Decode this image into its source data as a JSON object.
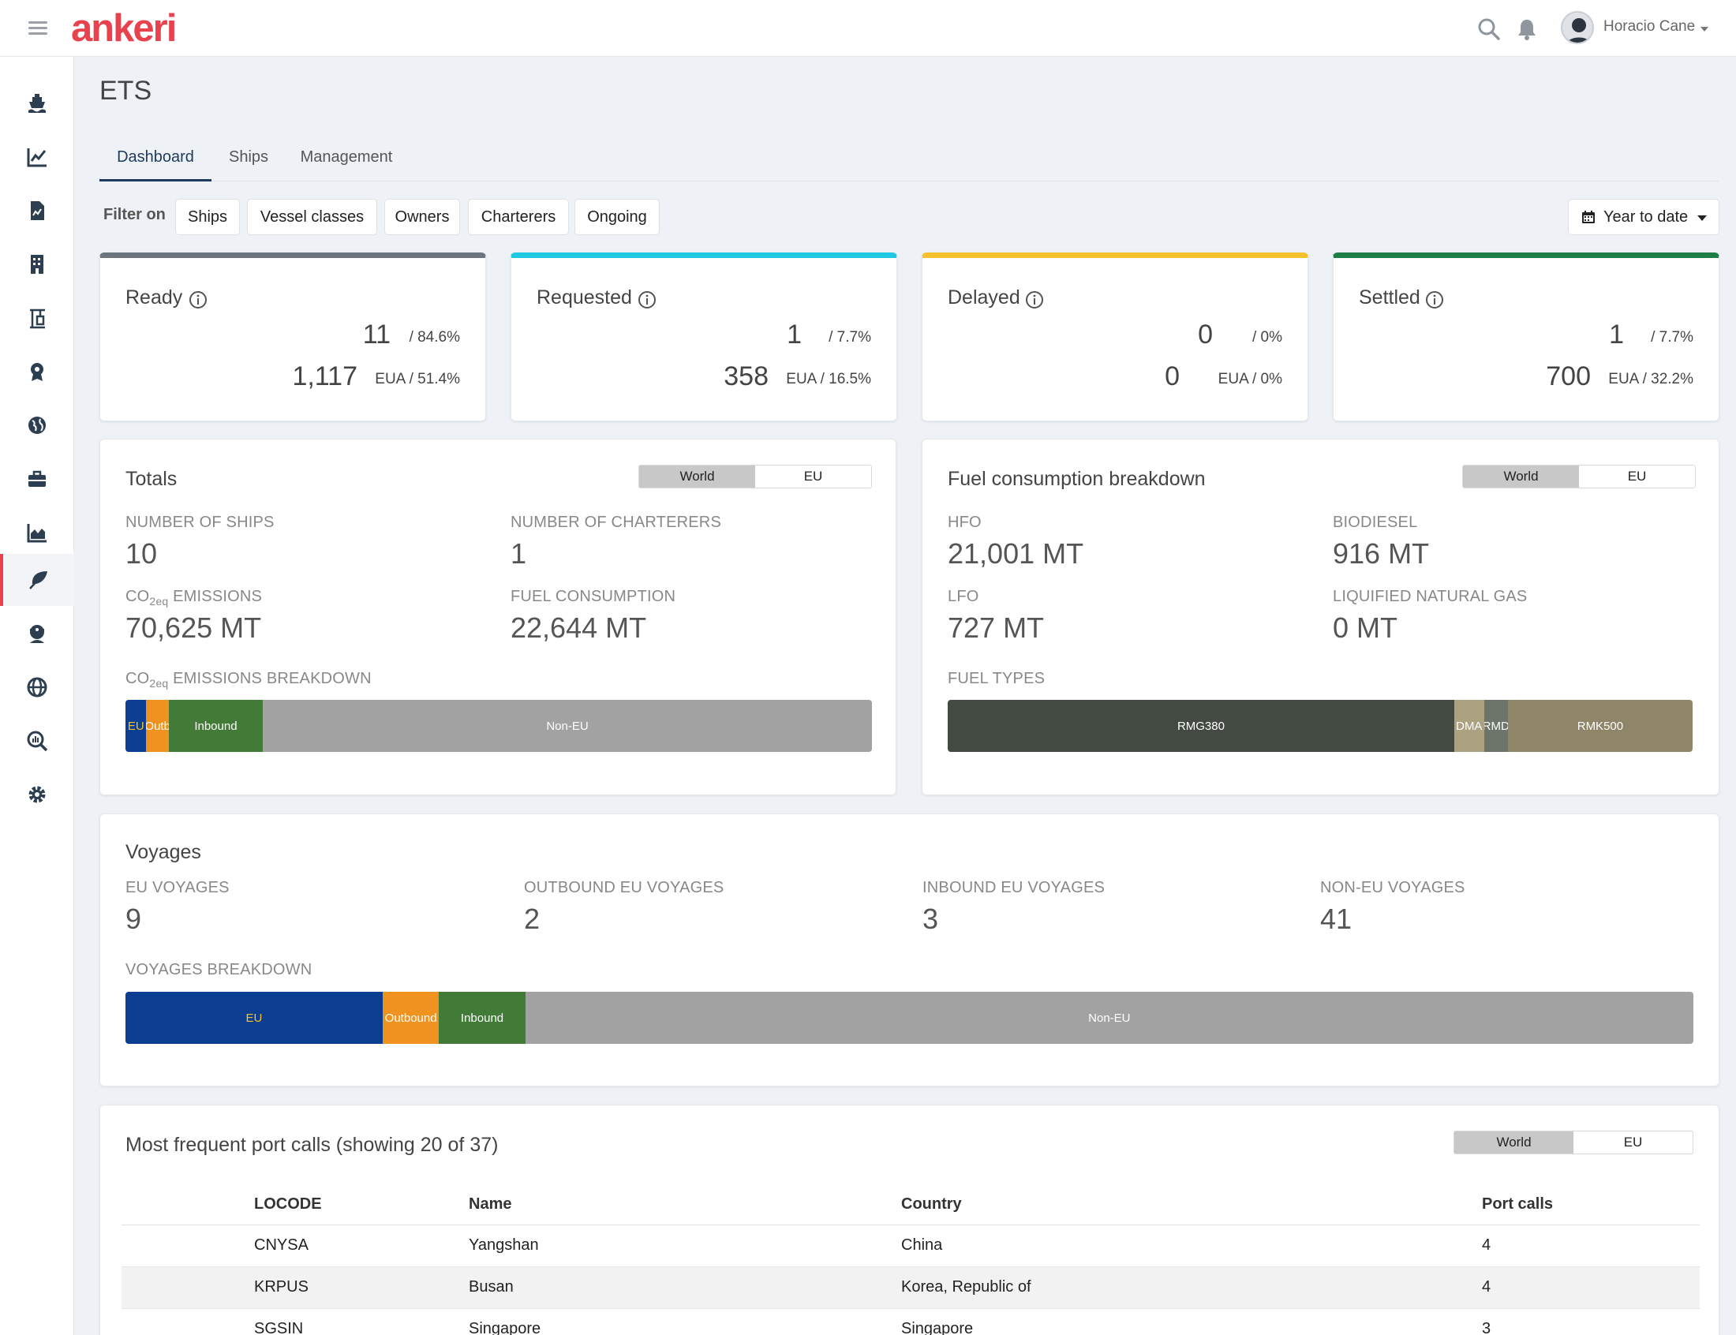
{
  "app": {
    "logo_text": "ankeri",
    "brand_color": "#e8424e",
    "user_name": "Horacio Cane"
  },
  "page_title": "ETS",
  "tabs": [
    {
      "label": "Dashboard",
      "active": true
    },
    {
      "label": "Ships",
      "active": false
    },
    {
      "label": "Management",
      "active": false
    }
  ],
  "filter": {
    "label": "Filter on",
    "chips": [
      "Ships",
      "Vessel classes",
      "Owners",
      "Charterers",
      "Ongoing"
    ],
    "date_range": "Year to date"
  },
  "status_cards": [
    {
      "title": "Ready",
      "count": "11",
      "count_pct": "/ 84.6%",
      "eua": "1,117",
      "eua_pct": "EUA / 51.4%",
      "color": "#6c757d"
    },
    {
      "title": "Requested",
      "count": "1",
      "count_pct": "/ 7.7%",
      "eua": "358",
      "eua_pct": "EUA / 16.5%",
      "color": "#1fc8e3"
    },
    {
      "title": "Delayed",
      "count": "0",
      "count_pct": "/ 0%",
      "eua": "0",
      "eua_pct": "EUA / 0%",
      "color": "#f5c12e"
    },
    {
      "title": "Settled",
      "count": "1",
      "count_pct": "/ 7.7%",
      "eua": "700",
      "eua_pct": "EUA / 32.2%",
      "color": "#1e7e45"
    }
  ],
  "totals": {
    "title": "Totals",
    "toggle": [
      "World",
      "EU"
    ],
    "toggle_selected": "World",
    "ships_label": "NUMBER OF SHIPS",
    "ships_value": "10",
    "charterers_label": "NUMBER OF CHARTERERS",
    "charterers_value": "1",
    "co2_label_pre": "CO",
    "co2_label_sub": "2eq",
    "co2_label_post": " EMISSIONS",
    "co2_value": "70,625 MT",
    "fuel_label": "FUEL CONSUMPTION",
    "fuel_value": "22,644 MT",
    "breakdown_label_post": " EMISSIONS BREAKDOWN",
    "breakdown": [
      {
        "label": "EU",
        "share": 2.8,
        "color": "#0b3d91",
        "text_color": "#f5c12e"
      },
      {
        "label": "Outb",
        "share": 3.0,
        "color": "#f0921f",
        "text_color": "#ffffff"
      },
      {
        "label": "Inbound",
        "share": 12.6,
        "color": "#417b37",
        "text_color": "#ffffff"
      },
      {
        "label": "Non-EU",
        "share": 81.6,
        "color": "#a2a2a2",
        "text_color": "#ffffff"
      }
    ]
  },
  "fuel": {
    "title": "Fuel consumption breakdown",
    "toggle": [
      "World",
      "EU"
    ],
    "toggle_selected": "World",
    "hfo_label": "HFO",
    "hfo_value": "21,001 MT",
    "bio_label": "BIODIESEL",
    "bio_value": "916 MT",
    "lfo_label": "LFO",
    "lfo_value": "727 MT",
    "lng_label": "LIQUIFIED NATURAL GAS",
    "lng_value": "0 MT",
    "types_label": "FUEL TYPES",
    "types": [
      {
        "label": "RMG380",
        "share": 68.0,
        "color": "#434a42",
        "text_color": "#ffffff"
      },
      {
        "label": "DMA",
        "share": 4.0,
        "color": "#aca282",
        "text_color": "#ffffff"
      },
      {
        "label": "RMD",
        "share": 3.2,
        "color": "#6d7469",
        "text_color": "#ffffff"
      },
      {
        "label": "RMK500",
        "share": 24.8,
        "color": "#8f8669",
        "text_color": "#ffffff"
      }
    ]
  },
  "voyages": {
    "title": "Voyages",
    "eu_label": "EU VOYAGES",
    "eu_value": "9",
    "outbound_label": "OUTBOUND EU VOYAGES",
    "outbound_value": "2",
    "inbound_label": "INBOUND EU VOYAGES",
    "inbound_value": "3",
    "noneu_label": "NON-EU VOYAGES",
    "noneu_value": "41",
    "breakdown_label": "VOYAGES BREAKDOWN",
    "breakdown": [
      {
        "label": "EU",
        "share": 16.4,
        "color": "#0b3d91",
        "text_color": "#f5c12e"
      },
      {
        "label": "Outbound",
        "share": 3.6,
        "color": "#f0921f",
        "text_color": "#ffffff"
      },
      {
        "label": "Inbound",
        "share": 5.5,
        "color": "#417b37",
        "text_color": "#ffffff"
      },
      {
        "label": "Non-EU",
        "share": 74.5,
        "color": "#a2a2a2",
        "text_color": "#ffffff"
      }
    ]
  },
  "port_calls": {
    "title": "Most frequent port calls (showing 20 of 37)",
    "toggle": [
      "World",
      "EU"
    ],
    "toggle_selected": "World",
    "columns": [
      "LOCODE",
      "Name",
      "Country",
      "Port calls"
    ],
    "rows": [
      [
        "CNYSA",
        "Yangshan",
        "China",
        "4"
      ],
      [
        "KRPUS",
        "Busan",
        "Korea, Republic of",
        "4"
      ],
      [
        "SGSIN",
        "Singapore",
        "Singapore",
        "3"
      ]
    ]
  },
  "sidebar_icons": [
    "ship-icon",
    "line-chart-icon",
    "document-icon",
    "building-icon",
    "crane-icon",
    "award-icon",
    "globe-icon",
    "toolbox-icon",
    "area-chart-icon",
    "leaf-icon",
    "captain-icon",
    "world-grid-icon",
    "search-chart-icon",
    "settings-gear-icon"
  ]
}
